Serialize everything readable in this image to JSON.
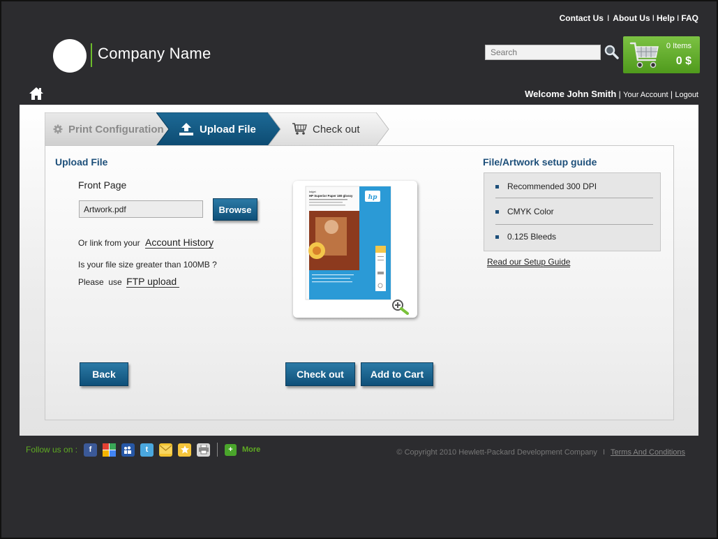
{
  "header": {
    "links": [
      "Contact Us",
      "About Us",
      "Help",
      "FAQ"
    ],
    "company_name": "Company Name",
    "search_placeholder": "Search",
    "cart_items": "0 Items",
    "cart_total": "0 $",
    "welcome_text": "Welcome John Smith",
    "your_account": "Your Account",
    "logout": "Logout"
  },
  "wizard": {
    "steps": [
      {
        "label": "Print Configuration",
        "state": "completed"
      },
      {
        "label": "Upload File",
        "state": "active"
      },
      {
        "label": "Check out",
        "state": "pending"
      }
    ]
  },
  "upload": {
    "title": "Upload File",
    "front_page_label": "Front Page",
    "file_value": "Artwork.pdf",
    "browse_label": "Browse",
    "link_prefix": "Or link from your",
    "account_history": "Account History",
    "size_question": "Is your file size greater than 100MB ?",
    "ftp_prefix": "Please  use",
    "ftp_link": "FTP upload"
  },
  "preview": {
    "product_name": "Inkjet",
    "product_title": "HP Superior Paper 180 glossy",
    "brand": "hp"
  },
  "guide": {
    "title": "File/Artwork setup guide",
    "items": [
      "Recommended 300 DPI",
      "CMYK Color",
      "0.125 Bleeds"
    ],
    "read_link": "Read our Setup Guide"
  },
  "actions": {
    "back": "Back",
    "checkout": "Check out",
    "add_to_cart": "Add to Cart"
  },
  "footer": {
    "follow_label": "Follow us on  :",
    "more_label": "More",
    "copyright": "© Copyright 2010 Hewlett-Packard Development Company",
    "separator": "I",
    "terms": "Terms And Conditions"
  },
  "colors": {
    "accent_blue": "#0f5079",
    "accent_green": "#6dbb2b",
    "background": "#2c2c2f"
  }
}
